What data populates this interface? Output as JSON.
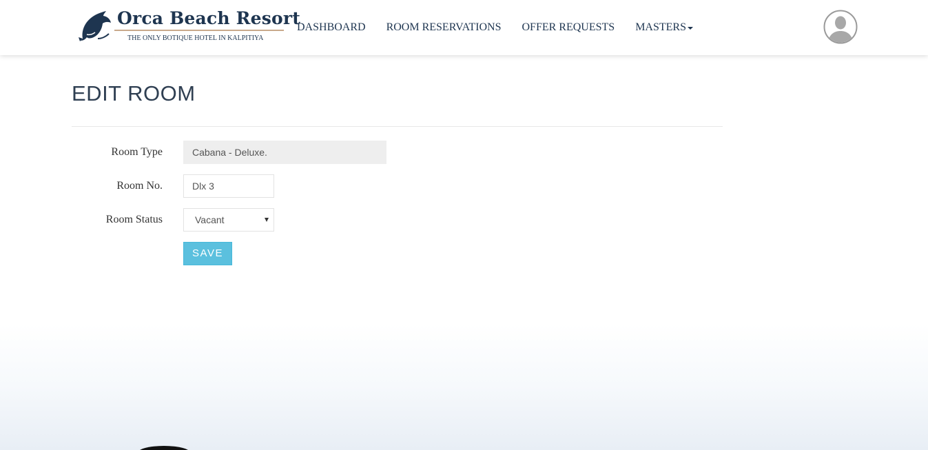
{
  "brand": {
    "name": "Orca Beach Resort",
    "tagline": "THE ONLY BOTIQUE HOTEL IN KALPITIYA",
    "logo_icon": "orca-icon",
    "color": "#1e3550",
    "accent": "#c9a98b"
  },
  "nav": {
    "items": [
      {
        "label": "DASHBOARD"
      },
      {
        "label": "ROOM RESERVATIONS"
      },
      {
        "label": "OFFER REQUESTS"
      },
      {
        "label": "MASTERS"
      }
    ],
    "dropdown_icon": "caret-down-icon",
    "avatar_icon": "user-avatar-icon"
  },
  "page": {
    "title": "EDIT ROOM"
  },
  "form": {
    "room_type": {
      "label": "Room Type",
      "value": "Cabana - Deluxe."
    },
    "room_no": {
      "label": "Room No.",
      "value": "Dlx 3"
    },
    "room_status": {
      "label": "Room Status",
      "value": "Vacant"
    },
    "save_label": "SAVE",
    "save_color": "#5bc0de"
  }
}
